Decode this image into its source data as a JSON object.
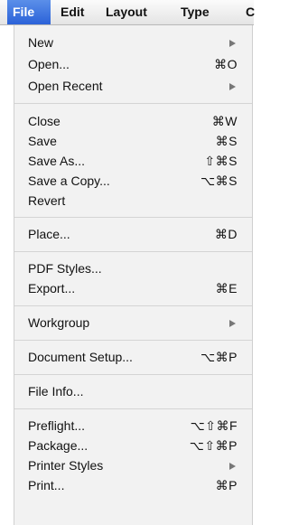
{
  "menubar": {
    "file": "File",
    "edit": "Edit",
    "layout": "Layout",
    "type": "Type",
    "partial": "C"
  },
  "menu": {
    "new": "New",
    "open": "Open...",
    "open_shortcut": "⌘O",
    "open_recent": "Open Recent",
    "close": "Close",
    "close_shortcut": "⌘W",
    "save": "Save",
    "save_shortcut": "⌘S",
    "save_as": "Save As...",
    "save_as_shortcut": "⇧⌘S",
    "save_copy": "Save a Copy...",
    "save_copy_shortcut": "⌥⌘S",
    "revert": "Revert",
    "place": "Place...",
    "place_shortcut": "⌘D",
    "pdf_styles": "PDF Styles...",
    "export": "Export...",
    "export_shortcut": "⌘E",
    "workgroup": "Workgroup",
    "document_setup": "Document Setup...",
    "document_setup_shortcut": "⌥⌘P",
    "file_info": "File Info...",
    "preflight": "Preflight...",
    "preflight_shortcut": "⌥⇧⌘F",
    "package": "Package...",
    "package_shortcut": "⌥⇧⌘P",
    "printer_styles": "Printer Styles",
    "print": "Print...",
    "print_shortcut": "⌘P"
  }
}
